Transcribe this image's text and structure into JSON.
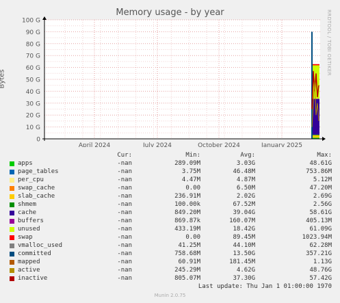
{
  "title": "Memory usage - by year",
  "side_note": "RRDTOOL / TOBI OETIKER",
  "ylabel": "Bytes",
  "legend_headers": {
    "cur": "Cur:",
    "min": "Min:",
    "avg": "Avg:",
    "max": "Max:"
  },
  "legend": [
    {
      "name": "apps",
      "color": "#00cc00",
      "cur": "-nan",
      "min": "289.09M",
      "avg": "3.03G",
      "max": "48.61G"
    },
    {
      "name": "page_tables",
      "color": "#0066b3",
      "cur": "-nan",
      "min": "3.75M",
      "avg": "46.48M",
      "max": "753.86M"
    },
    {
      "name": "per_cpu",
      "color": "#ffee88",
      "cur": "-nan",
      "min": "4.47M",
      "avg": "4.87M",
      "max": "5.12M"
    },
    {
      "name": "swap_cache",
      "color": "#ff8000",
      "cur": "-nan",
      "min": "0.00",
      "avg": "6.50M",
      "max": "47.20M"
    },
    {
      "name": "slab_cache",
      "color": "#ffcc00",
      "cur": "-nan",
      "min": "236.91M",
      "avg": "2.02G",
      "max": "2.69G"
    },
    {
      "name": "shmem",
      "color": "#008f00",
      "cur": "-nan",
      "min": "100.00k",
      "avg": "67.52M",
      "max": "2.56G"
    },
    {
      "name": "cache",
      "color": "#330099",
      "cur": "-nan",
      "min": "849.20M",
      "avg": "39.04G",
      "max": "58.61G"
    },
    {
      "name": "buffers",
      "color": "#990099",
      "cur": "-nan",
      "min": "869.87k",
      "avg": "160.07M",
      "max": "405.13M"
    },
    {
      "name": "unused",
      "color": "#ccff00",
      "cur": "-nan",
      "min": "433.19M",
      "avg": "18.42G",
      "max": "61.09G"
    },
    {
      "name": "swap",
      "color": "#ff0000",
      "cur": "-nan",
      "min": "0.00",
      "avg": "89.45M",
      "max": "1023.94M"
    },
    {
      "name": "vmalloc_used",
      "color": "#808080",
      "cur": "-nan",
      "min": "41.25M",
      "avg": "44.10M",
      "max": "62.28M"
    },
    {
      "name": "committed",
      "color": "#004d80",
      "cur": "-nan",
      "min": "758.68M",
      "avg": "13.50G",
      "max": "357.21G"
    },
    {
      "name": "mapped",
      "color": "#b35a00",
      "cur": "-nan",
      "min": "60.91M",
      "avg": "181.45M",
      "max": "1.13G"
    },
    {
      "name": "active",
      "color": "#b38f00",
      "cur": "-nan",
      "min": "245.29M",
      "avg": "4.62G",
      "max": "48.76G"
    },
    {
      "name": "inactive",
      "color": "#b30000",
      "cur": "-nan",
      "min": "805.07M",
      "avg": "37.30G",
      "max": "57.42G"
    }
  ],
  "last_update": "Last update: Thu Jan  1 01:00:00 1970",
  "footer": "Munin 2.0.75",
  "chart_data": {
    "type": "area",
    "title": "Memory usage - by year",
    "ylabel": "Bytes",
    "ylim": [
      0,
      100
    ],
    "y_unit": "G",
    "yticks": [
      "0",
      "10 G",
      "20 G",
      "30 G",
      "40 G",
      "50 G",
      "60 G",
      "70 G",
      "80 G",
      "90 G",
      "100 G"
    ],
    "xticks": [
      "April 2024",
      "July 2024",
      "October 2024",
      "January 2025"
    ],
    "grid": true,
    "note": "stacked memory areas appear only at the far right edge (approx. last weeks of the period)",
    "stack_end_values_G": {
      "apps": 1,
      "slab_cache": 2,
      "shmem": 0.5,
      "cache": 30,
      "buffers": 0.3,
      "unused": 28,
      "swap": 1
    },
    "lines_peak_G": {
      "committed": 90,
      "inactive": 57,
      "active": 48
    }
  }
}
